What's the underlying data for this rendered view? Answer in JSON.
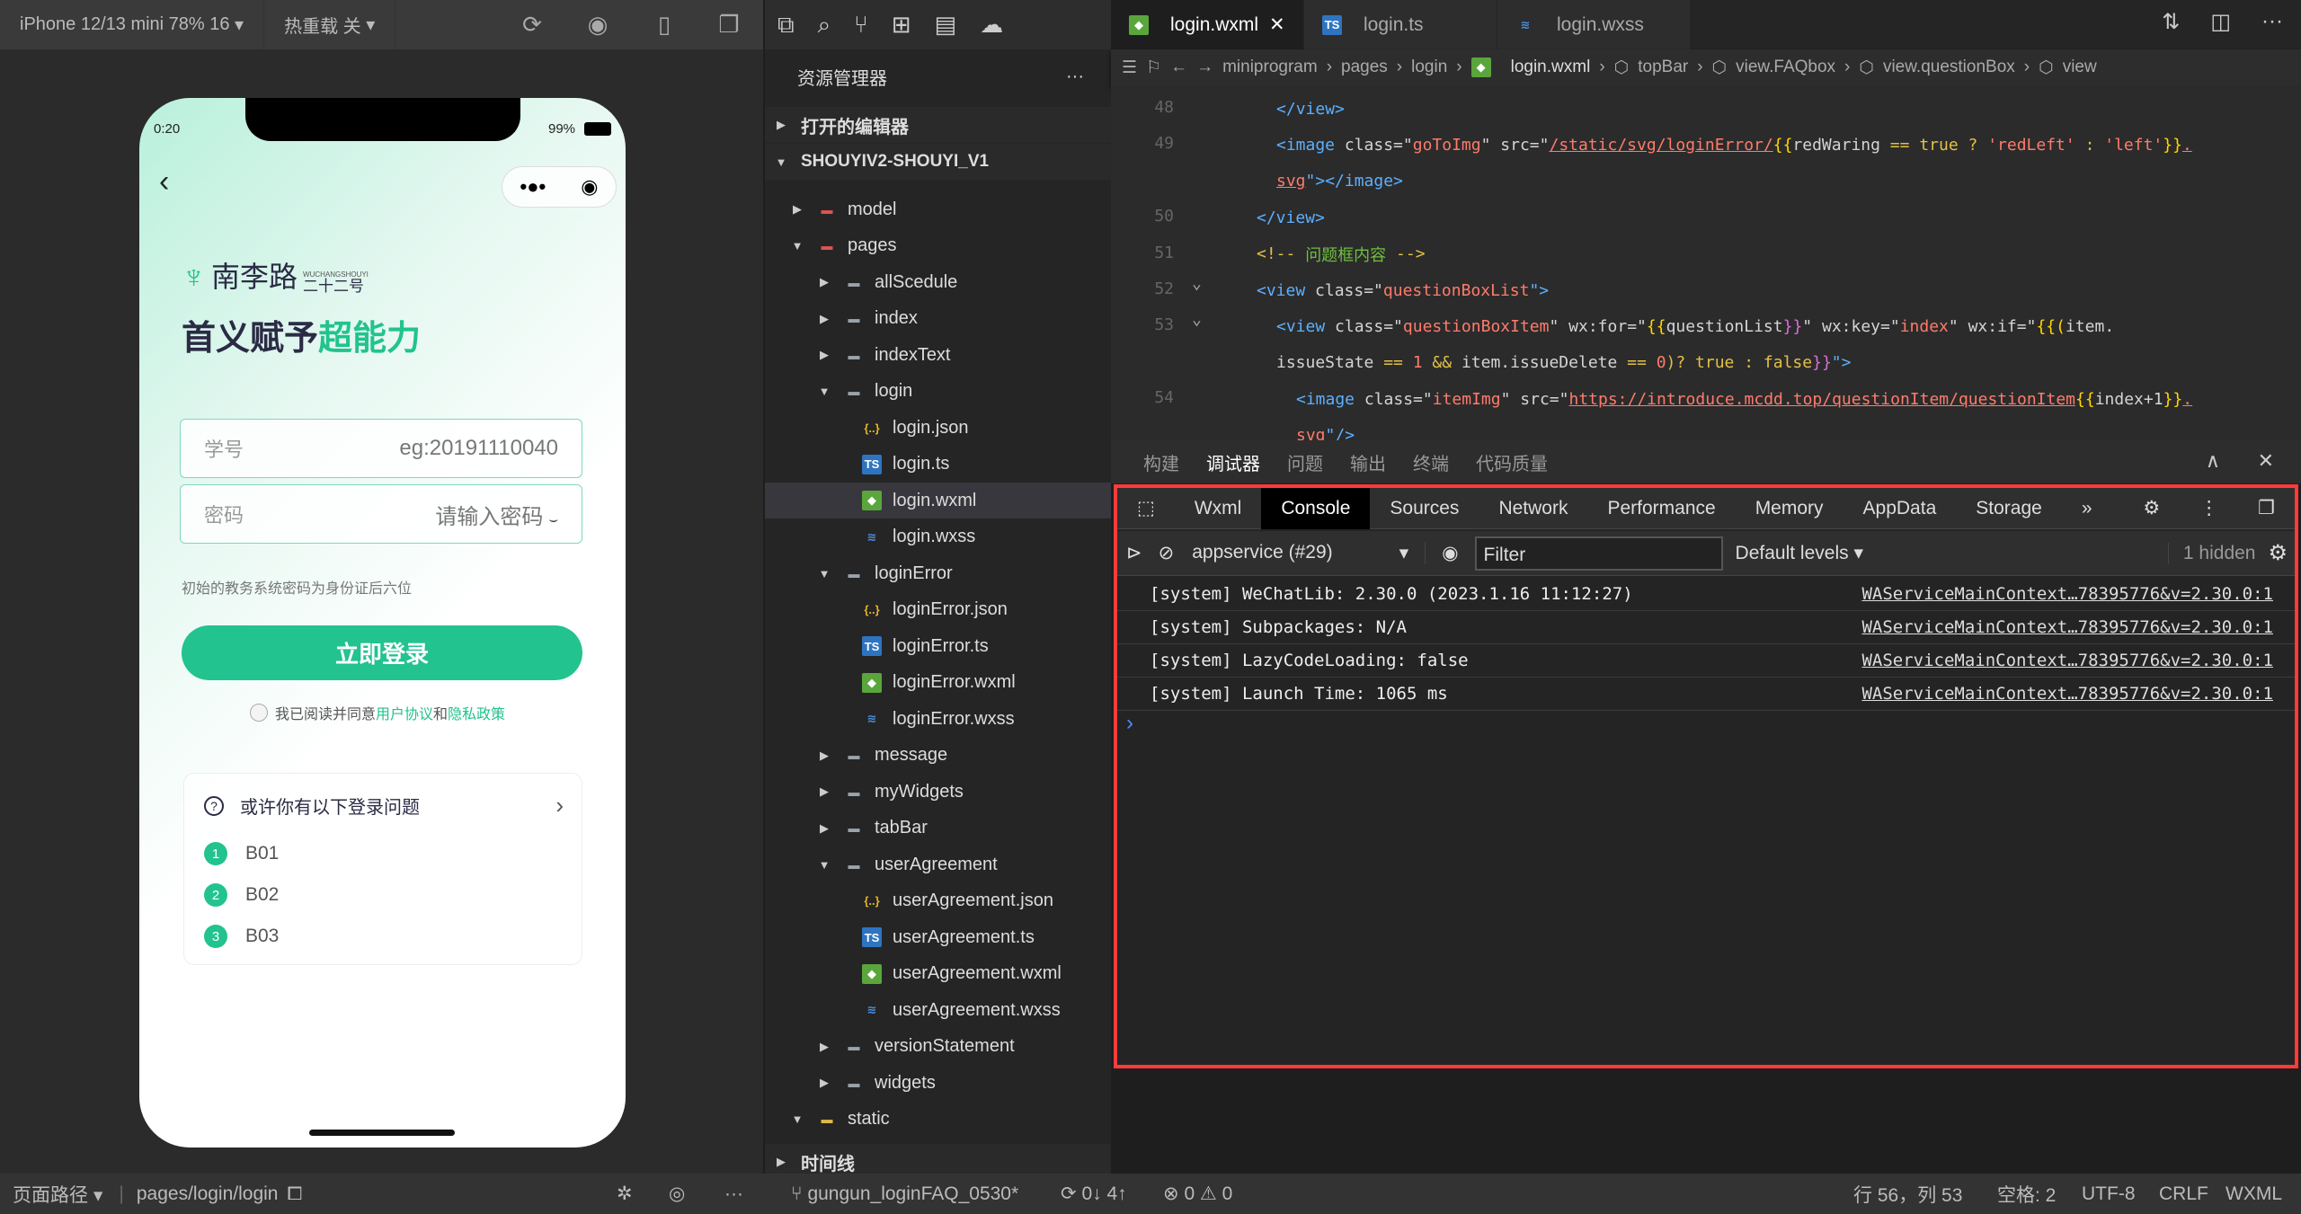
{
  "simulator": {
    "device": "iPhone 12/13 mini 78% 16",
    "hotreload": "热重载 关",
    "phone": {
      "time": "0:20",
      "battery": "99%",
      "brand": "南李路",
      "brand_sub": "二十二号",
      "brand_en": "WUCHANGSHOUYI",
      "slogan_a": "首义赋予",
      "slogan_b": "超能力",
      "id_label": "学号",
      "id_placeholder": "eg:20191110040",
      "pwd_label": "密码",
      "pwd_placeholder": "请输入密码",
      "hint": "初始的教务系统密码为身份证后六位",
      "login": "立即登录",
      "agree": "我已阅读并同意",
      "agree_link1": "用户协议",
      "agree_and": "和",
      "agree_link2": "隐私政策",
      "faq_title": "或许你有以下登录问题",
      "faq_items": [
        {
          "n": "1",
          "t": "B01"
        },
        {
          "n": "2",
          "t": "B02"
        },
        {
          "n": "3",
          "t": "B03"
        }
      ]
    }
  },
  "explorer": {
    "title": "资源管理器",
    "open_editors": "打开的编辑器",
    "project": "SHOUYIV2-SHOUYI_V1",
    "timeline": "时间线",
    "tree": [
      {
        "l": "model",
        "d": 1,
        "t": "folder-red",
        "o": false
      },
      {
        "l": "pages",
        "d": 1,
        "t": "folder-red",
        "o": true
      },
      {
        "l": "allScedule",
        "d": 2,
        "t": "folder",
        "o": false
      },
      {
        "l": "index",
        "d": 2,
        "t": "folder",
        "o": false
      },
      {
        "l": "indexText",
        "d": 2,
        "t": "folder",
        "o": false
      },
      {
        "l": "login",
        "d": 2,
        "t": "folder",
        "o": true
      },
      {
        "l": "login.json",
        "d": 3,
        "t": "json"
      },
      {
        "l": "login.ts",
        "d": 3,
        "t": "ts"
      },
      {
        "l": "login.wxml",
        "d": 3,
        "t": "wxml",
        "sel": true
      },
      {
        "l": "login.wxss",
        "d": 3,
        "t": "wxss"
      },
      {
        "l": "loginError",
        "d": 2,
        "t": "folder",
        "o": true
      },
      {
        "l": "loginError.json",
        "d": 3,
        "t": "json"
      },
      {
        "l": "loginError.ts",
        "d": 3,
        "t": "ts"
      },
      {
        "l": "loginError.wxml",
        "d": 3,
        "t": "wxml"
      },
      {
        "l": "loginError.wxss",
        "d": 3,
        "t": "wxss"
      },
      {
        "l": "message",
        "d": 2,
        "t": "folder",
        "o": false
      },
      {
        "l": "myWidgets",
        "d": 2,
        "t": "folder",
        "o": false
      },
      {
        "l": "tabBar",
        "d": 2,
        "t": "folder",
        "o": false
      },
      {
        "l": "userAgreement",
        "d": 2,
        "t": "folder",
        "o": true
      },
      {
        "l": "userAgreement.json",
        "d": 3,
        "t": "json"
      },
      {
        "l": "userAgreement.ts",
        "d": 3,
        "t": "ts"
      },
      {
        "l": "userAgreement.wxml",
        "d": 3,
        "t": "wxml"
      },
      {
        "l": "userAgreement.wxss",
        "d": 3,
        "t": "wxss"
      },
      {
        "l": "versionStatement",
        "d": 2,
        "t": "folder",
        "o": false
      },
      {
        "l": "widgets",
        "d": 2,
        "t": "folder",
        "o": false
      },
      {
        "l": "static",
        "d": 1,
        "t": "folder-yellow",
        "o": true
      }
    ]
  },
  "editor": {
    "tabs": [
      {
        "l": "login.wxml",
        "t": "wxml",
        "active": true
      },
      {
        "l": "login.ts",
        "t": "ts"
      },
      {
        "l": "login.wxss",
        "t": "wxss"
      }
    ],
    "breadcrumb": [
      "miniprogram",
      "pages",
      "login",
      "login.wxml",
      "topBar",
      "view.FAQbox",
      "view.questionBox",
      "view"
    ],
    "lines": [
      {
        "n": "48",
        "i": 2,
        "tk": [
          [
            "</",
            "k"
          ],
          [
            "view",
            "k"
          ],
          [
            ">",
            "k"
          ]
        ]
      },
      {
        "n": "49",
        "i": 2,
        "tk": [
          [
            "<image ",
            "k"
          ],
          [
            "class",
            "a"
          ],
          [
            "=\"",
            "w"
          ],
          [
            "goToImg",
            "s"
          ],
          [
            "\" ",
            "w"
          ],
          [
            "src",
            "a"
          ],
          [
            "=\"",
            "w"
          ],
          [
            "/static/svg/loginError/",
            "u"
          ],
          [
            "{{",
            "b"
          ],
          [
            "redWaring ",
            "w"
          ],
          [
            "== ",
            "y"
          ],
          [
            "true ",
            "y"
          ],
          [
            "? ",
            "y"
          ],
          [
            "'redLeft' ",
            "s"
          ],
          [
            ": ",
            "y"
          ],
          [
            "'left'",
            "s"
          ],
          [
            "}}",
            "b"
          ],
          [
            ".",
            "u"
          ]
        ]
      },
      {
        "n": "",
        "i": 2,
        "tk": [
          [
            "svg",
            "u"
          ],
          [
            "\"></image>",
            "k"
          ]
        ]
      },
      {
        "n": "50",
        "i": 1,
        "tk": [
          [
            "</view>",
            "k"
          ]
        ]
      },
      {
        "n": "51",
        "i": 1,
        "tk": [
          [
            "<!-- ",
            "y"
          ],
          [
            "问题框内容",
            "c"
          ],
          [
            " -->",
            "y"
          ]
        ]
      },
      {
        "n": "52",
        "i": 1,
        "tk": [
          [
            "<view ",
            "k"
          ],
          [
            "class",
            "a"
          ],
          [
            "=\"",
            "w"
          ],
          [
            "questionBoxList",
            "s"
          ],
          [
            "\">",
            "k"
          ]
        ]
      },
      {
        "n": "53",
        "i": 2,
        "tk": [
          [
            "<view ",
            "k"
          ],
          [
            "class",
            "a"
          ],
          [
            "=\"",
            "w"
          ],
          [
            "questionBoxItem",
            "s"
          ],
          [
            "\" ",
            "w"
          ],
          [
            "wx:for",
            "a"
          ],
          [
            "=\"",
            "w"
          ],
          [
            "{{",
            "b"
          ],
          [
            "questionList",
            "w"
          ],
          [
            "}}",
            "p"
          ],
          [
            "\" ",
            "w"
          ],
          [
            "wx:key",
            "a"
          ],
          [
            "=\"",
            "w"
          ],
          [
            "index",
            "s"
          ],
          [
            "\" ",
            "w"
          ],
          [
            "wx:if",
            "a"
          ],
          [
            "=\"",
            "w"
          ],
          [
            "{{(",
            "b"
          ],
          [
            "item.",
            "w"
          ]
        ]
      },
      {
        "n": "",
        "i": 2,
        "tk": [
          [
            "issueState ",
            "w"
          ],
          [
            "== ",
            "y"
          ],
          [
            "1 ",
            "n"
          ],
          [
            "&& ",
            "y"
          ],
          [
            "item.issueDelete ",
            "w"
          ],
          [
            "== ",
            "y"
          ],
          [
            "0",
            "n"
          ],
          [
            ")? ",
            "y"
          ],
          [
            "true ",
            "y"
          ],
          [
            ": ",
            "y"
          ],
          [
            "false",
            "y"
          ],
          [
            "}}",
            "p"
          ],
          [
            "\">",
            "k"
          ]
        ]
      },
      {
        "n": "54",
        "i": 3,
        "tk": [
          [
            "<image ",
            "k"
          ],
          [
            "class",
            "a"
          ],
          [
            "=\"",
            "w"
          ],
          [
            "itemImg",
            "s"
          ],
          [
            "\" ",
            "w"
          ],
          [
            "src",
            "a"
          ],
          [
            "=\"",
            "w"
          ],
          [
            "https://introduce.mcdd.top/questionItem/questionItem",
            "u"
          ],
          [
            "{{",
            "b"
          ],
          [
            "index+1",
            "w"
          ],
          [
            "}}",
            "b"
          ],
          [
            ".",
            "u"
          ]
        ]
      },
      {
        "n": "",
        "i": 3,
        "tk": [
          [
            "svg",
            "u"
          ],
          [
            "\"/>",
            "k"
          ]
        ]
      }
    ]
  },
  "panel": {
    "tabs": [
      "构建",
      "调试器",
      "问题",
      "输出",
      "终端",
      "代码质量"
    ],
    "active": "调试器",
    "devtools_tabs": [
      "Wxml",
      "Console",
      "Sources",
      "Network",
      "Performance",
      "Memory",
      "AppData",
      "Storage"
    ],
    "devtools_active": "Console",
    "context": "appservice (#29)",
    "filter_placeholder": "Filter",
    "levels": "Default levels",
    "hidden": "1 hidden",
    "logs": [
      {
        "msg": "[system] WeChatLib: 2.30.0 (2023.1.16 11:12:27)",
        "src": "WAServiceMainContext…78395776&v=2.30.0:1"
      },
      {
        "msg": "[system] Subpackages: N/A",
        "src": "WAServiceMainContext…78395776&v=2.30.0:1"
      },
      {
        "msg": "[system] LazyCodeLoading: false",
        "src": "WAServiceMainContext…78395776&v=2.30.0:1"
      },
      {
        "msg": "[system] Launch Time: 1065 ms",
        "src": "WAServiceMainContext…78395776&v=2.30.0:1"
      }
    ],
    "highlight_color": "#ff3b3b"
  },
  "status": {
    "page_path_label": "页面路径",
    "page_path": "pages/login/login",
    "branch": "gungun_loginFAQ_0530*",
    "sync": "0↓ 4↑",
    "errors": "0",
    "warnings": "0",
    "position": "行 56，列 53",
    "spaces": "空格: 2",
    "encoding": "UTF-8",
    "eol": "CRLF",
    "lang": "WXML"
  },
  "colors": {
    "accent": "#22c38e"
  }
}
